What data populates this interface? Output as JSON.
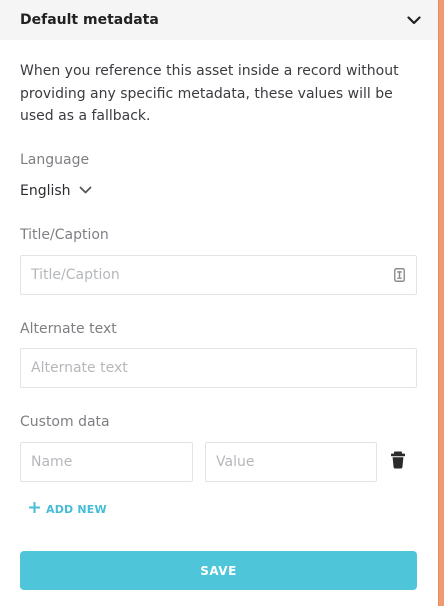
{
  "header": {
    "title": "Default metadata",
    "toggle_icon": "chevron-down-icon"
  },
  "description": "When you reference this asset inside a record without providing any specific metadata, these values will be used as a fallback.",
  "language": {
    "label": "Language",
    "value": "English",
    "icon": "chevron-down-icon"
  },
  "title_caption": {
    "label": "Title/Caption",
    "placeholder": "Title/Caption",
    "icon": "text-format-icon"
  },
  "alternate_text": {
    "label": "Alternate text",
    "placeholder": "Alternate text"
  },
  "custom_data": {
    "label": "Custom data",
    "name_placeholder": "Name",
    "value_placeholder": "Value",
    "delete_icon": "trash-icon"
  },
  "add_new": {
    "label": "ADD NEW",
    "icon": "plus-icon"
  },
  "save": {
    "label": "SAVE"
  },
  "colors": {
    "accent": "#4fc5da",
    "link": "#46bcd6",
    "side_bar": "#f09a73",
    "header_bg": "#f5f5f5"
  }
}
